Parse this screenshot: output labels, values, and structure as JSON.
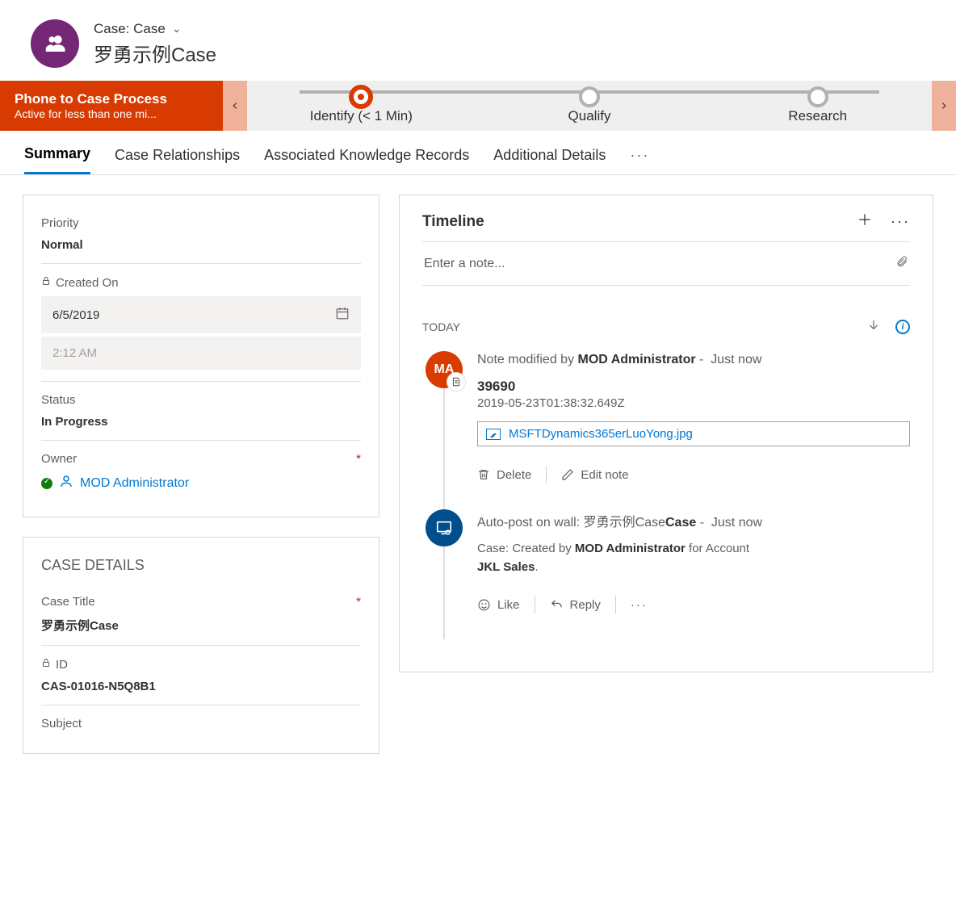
{
  "header": {
    "entity_label": "Case: Case",
    "title": "罗勇示例Case"
  },
  "bpf": {
    "process_name": "Phone to Case Process",
    "status_text": "Active for less than one mi...",
    "stages": [
      {
        "label": "Identify  (< 1 Min)",
        "active": true
      },
      {
        "label": "Qualify",
        "active": false
      },
      {
        "label": "Research",
        "active": false
      }
    ]
  },
  "tabs": [
    "Summary",
    "Case Relationships",
    "Associated Knowledge Records",
    "Additional Details"
  ],
  "details": {
    "priority_label": "Priority",
    "priority_value": "Normal",
    "createdon_label": "Created On",
    "createdon_date": "6/5/2019",
    "createdon_time": "2:12 AM",
    "status_label": "Status",
    "status_value": "In Progress",
    "owner_label": "Owner",
    "owner_value": "MOD Administrator"
  },
  "case_section": {
    "title": "CASE DETAILS",
    "case_title_label": "Case Title",
    "case_title_value": "罗勇示例Case",
    "id_label": "ID",
    "id_value": "CAS-01016-N5Q8B1",
    "subject_label": "Subject"
  },
  "timeline": {
    "heading": "Timeline",
    "note_placeholder": "Enter a note...",
    "today_label": "TODAY",
    "item1": {
      "prefix": "Note modified by ",
      "actor": "MOD Administrator",
      "age": "Just now",
      "title": "39690",
      "timestamp": "2019-05-23T01:38:32.649Z",
      "attachment": "MSFTDynamics365erLuoYong.jpg",
      "delete": "Delete",
      "edit": "Edit note",
      "initials": "MA"
    },
    "item2": {
      "prefix": "Auto-post on wall: ",
      "subject": "罗勇示例Case",
      "age": "Just now",
      "body_prefix": "Case: Created by ",
      "body_actor": "MOD Administrator",
      "body_mid": " for Account ",
      "body_account": "JKL Sales",
      "body_suffix": ".",
      "like": "Like",
      "reply": "Reply"
    }
  }
}
